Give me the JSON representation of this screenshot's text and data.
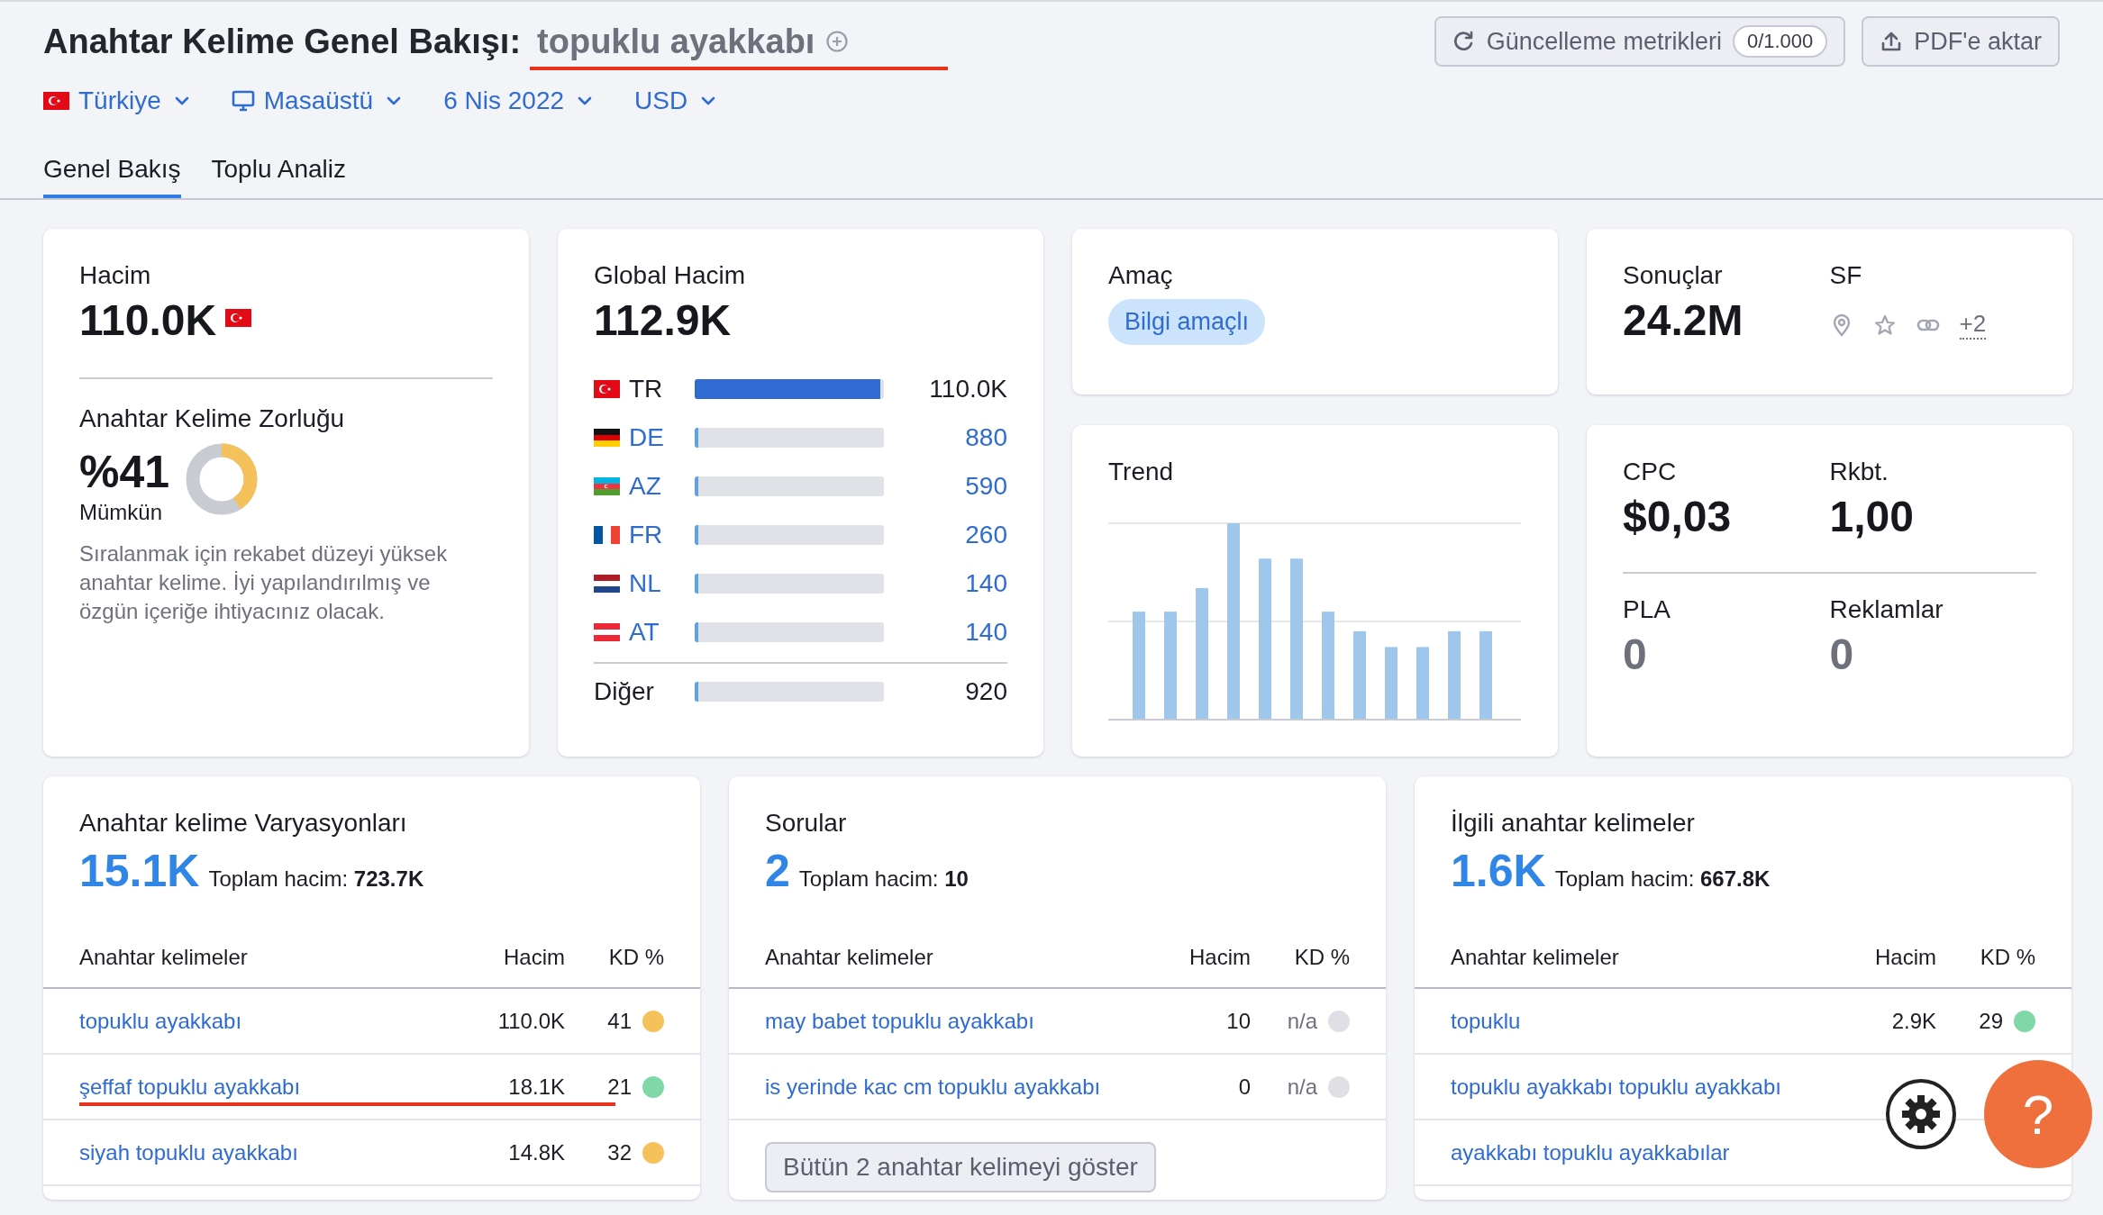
{
  "header": {
    "title": "Anahtar Kelime Genel Bakışı:",
    "keyword": {
      "text": "topuklu ayakkabı",
      "underlined": true
    },
    "buttons": [
      {
        "kind": "update",
        "label": "Güncelleme metrikleri",
        "badge": "0/1.000"
      },
      {
        "kind": "export",
        "label": "PDF'e aktar"
      }
    ]
  },
  "filters": [
    {
      "kind": "country",
      "label": "Türkiye"
    },
    {
      "kind": "device",
      "label": "Masaüstü"
    },
    {
      "kind": "plain",
      "label": "6 Nis 2022"
    },
    {
      "kind": "plain",
      "label": "USD"
    }
  ],
  "tabs": [
    {
      "label": "Genel Bakış",
      "selected": true
    },
    {
      "label": "Toplu Analiz",
      "selected": false
    }
  ],
  "volume": {
    "label": "Hacim",
    "value": "110.0K"
  },
  "difficulty": {
    "label": "Anahtar Kelime Zorluğu",
    "value": "%41",
    "level": 0.41,
    "rating": "Mümkün",
    "description": "Sıralanmak için rekabet düzeyi yüksek anahtar kelime. İyi yapılandırılmış ve özgün içeriğe ihtiyacınız olacak."
  },
  "global_volume": {
    "label": "Global Hacim",
    "value": "112.9K",
    "countries": [
      {
        "kind": "tr",
        "code": "TR",
        "value": "110.0K",
        "level": 0.98,
        "linked": false
      },
      {
        "kind": "de",
        "code": "DE",
        "value": "880",
        "level": 0.02,
        "linked": true
      },
      {
        "kind": "az",
        "code": "AZ",
        "value": "590",
        "level": 0.02,
        "linked": true
      },
      {
        "kind": "fr",
        "code": "FR",
        "value": "260",
        "level": 0.02,
        "linked": true
      },
      {
        "kind": "nl",
        "code": "NL",
        "value": "140",
        "level": 0.02,
        "linked": true
      },
      {
        "kind": "at",
        "code": "AT",
        "value": "140",
        "level": 0.02,
        "linked": true
      }
    ],
    "other": {
      "label": "Diğer",
      "value": "920",
      "level": 0.02
    }
  },
  "intent": {
    "label": "Amaç",
    "badge": "Bilgi amaçlı"
  },
  "trend": {
    "label": "Trend"
  },
  "results": {
    "label": "Sonuçlar",
    "value": "24.2M",
    "sf_label": "SF",
    "sf_more": "+2"
  },
  "metrics": [
    {
      "label": "CPC",
      "value": "$0,03",
      "muted": false
    },
    {
      "label": "Rkbt.",
      "value": "1,00",
      "muted": false
    },
    {
      "label": "PLA",
      "value": "0",
      "muted": true
    },
    {
      "label": "Reklamlar",
      "value": "0",
      "muted": true
    }
  ],
  "panels": [
    {
      "title": "Anahtar kelime Varyasyonları",
      "count": "15.1K",
      "total_label": "Toplam hacim:",
      "total": "723.7K",
      "columns": [
        "Anahtar kelimeler",
        "Hacim",
        "KD %"
      ],
      "rows": [
        {
          "keyword": "topuklu ayakkabı",
          "volume": "110.0K",
          "kd": "41",
          "color": "#f4c15a",
          "underlined": false
        },
        {
          "keyword": "şeffaf topuklu ayakkabı",
          "volume": "18.1K",
          "kd": "21",
          "color": "#7fd8a6",
          "underlined": true
        },
        {
          "keyword": "siyah topuklu ayakkabı",
          "volume": "14.8K",
          "kd": "32",
          "color": "#f4c15a",
          "underlined": false
        }
      ]
    },
    {
      "title": "Sorular",
      "count": "2",
      "total_label": "Toplam hacim:",
      "total": "10",
      "columns": [
        "Anahtar kelimeler",
        "Hacim",
        "KD %"
      ],
      "rows": [
        {
          "keyword": "may babet topuklu ayakkabı",
          "volume": "10",
          "kd": "n/a",
          "color": "#dfe0e6",
          "underlined": false
        },
        {
          "keyword": "is yerinde kac cm topuklu ayakkabı",
          "volume": "0",
          "kd": "n/a",
          "color": "#dfe0e6",
          "underlined": false
        }
      ],
      "button": "Bütün 2 anahtar kelimeyi göster"
    },
    {
      "title": "İlgili anahtar kelimeler",
      "count": "1.6K",
      "total_label": "Toplam hacim:",
      "total": "667.8K",
      "columns": [
        "Anahtar kelimeler",
        "Hacim",
        "KD %"
      ],
      "rows": [
        {
          "keyword": "topuklu",
          "volume": "2.9K",
          "kd": "29",
          "color": "#7fd8a6",
          "underlined": false
        },
        {
          "keyword": "topuklu ayakkabı topuklu ayakkabı",
          "underlined": false
        },
        {
          "keyword": "ayakkabı topuklu ayakkabılar",
          "underlined": false
        }
      ]
    }
  ],
  "help": {
    "label": "?"
  }
}
